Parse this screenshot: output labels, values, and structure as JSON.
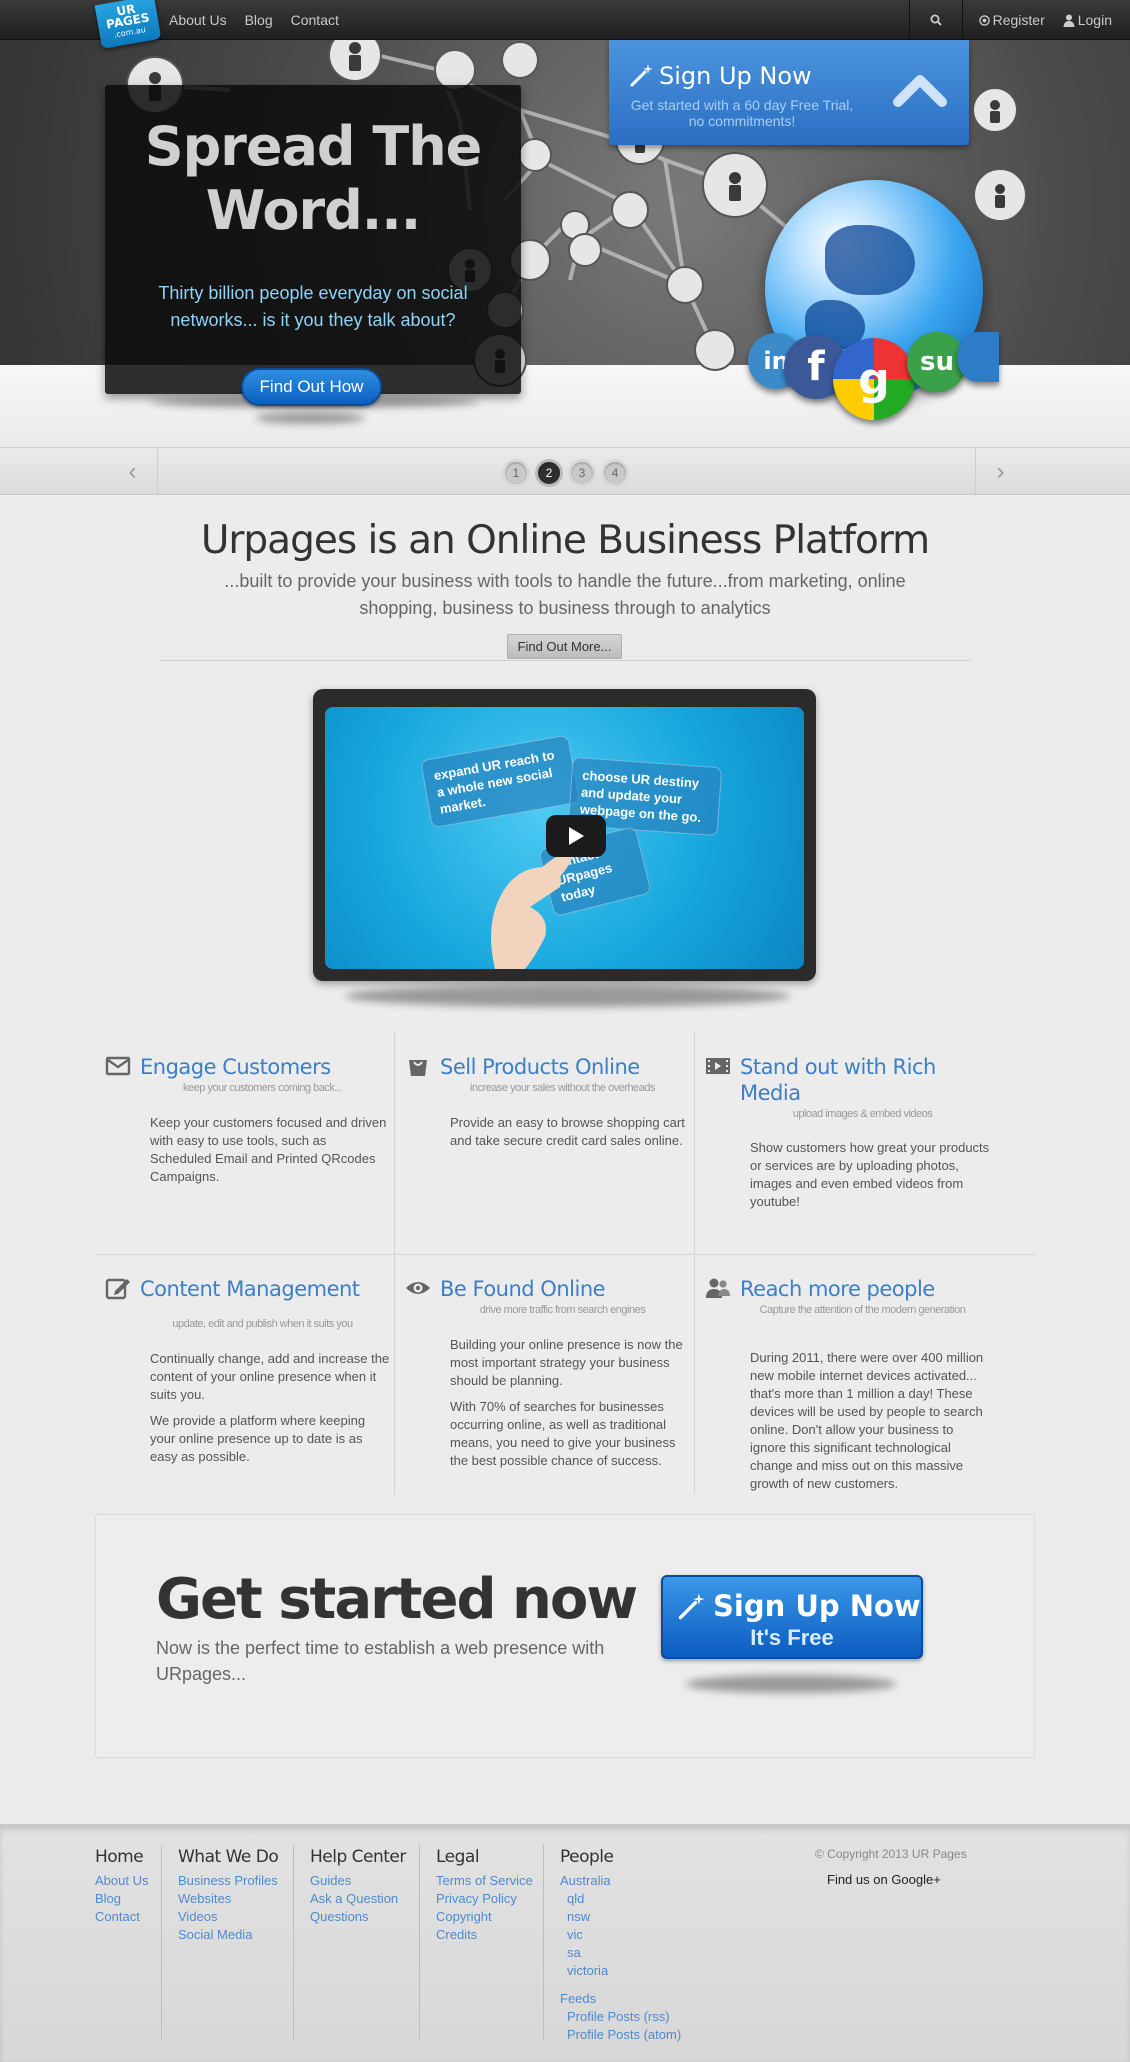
{
  "nav": {
    "logo_line1": "UR",
    "logo_line2": "PAGES",
    "logo_line3": ".com.au",
    "links": [
      "About Us",
      "Blog",
      "Contact"
    ],
    "register": "Register",
    "login": "Login"
  },
  "hero": {
    "title": "Spread The Word...",
    "subtitle": "Thirty billion people everyday on social networks... is it you they talk about?",
    "button": "Find Out How",
    "signup_title": "Sign Up Now",
    "signup_sub": "Get started with a 60 day Free Trial, no commitments!"
  },
  "slider": {
    "prev": "‹",
    "next": "›",
    "pages": [
      "1",
      "2",
      "3",
      "4"
    ],
    "active_page": 2
  },
  "intro": {
    "title": "Urpages is an Online Business Platform",
    "subtitle": "...built to provide your business with tools to handle the future...from marketing, online shopping, business to business through to analytics",
    "button": "Find Out More..."
  },
  "video": {
    "card1": "expand UR reach to a whole new social market.",
    "card2": "choose UR destiny and update your webpage on the go.",
    "card3": "contact URpages today"
  },
  "features": [
    {
      "icon": "envelope-icon",
      "title": "Engage Customers",
      "tagline": "keep your customers coming back...",
      "text": [
        "Keep your customers focused and driven with easy to use tools, such as Scheduled Email and Printed QRcodes Campaigns."
      ]
    },
    {
      "icon": "basket-icon",
      "title": "Sell Products Online",
      "tagline": "increase your sales without the overheads",
      "text": [
        "Provide an easy to browse shopping cart and take secure credit card sales online."
      ]
    },
    {
      "icon": "film-icon",
      "title": "Stand out with Rich Media",
      "tagline": "upload images & embed videos",
      "text": [
        "Show customers how great your products or services are by uploading photos, images and even embed videos from youtube!"
      ]
    },
    {
      "icon": "edit-icon",
      "title": "Content Management",
      "tagline": "update, edit and publish when it suits you",
      "text": [
        "Continually change, add and increase the content of your online presence when it suits you.",
        "We provide a platform where keeping your online presence up to date is as easy as possible."
      ]
    },
    {
      "icon": "eye-icon",
      "title": "Be Found Online",
      "tagline": "drive more traffic from search engines",
      "text": [
        "Building your online presence is now the most important strategy your business should be planning.",
        "With 70% of searches for businesses occurring online, as well as traditional means, you need to give your business the best possible chance of success."
      ]
    },
    {
      "icon": "people-icon",
      "title": "Reach more people",
      "tagline": "Capture the attention of the modern generation",
      "text": [
        "During 2011, there were over 400 million new mobile internet devices activated... that's more than 1 million a day! These devices will be used by people to search online. Don't allow your business to ignore this significant technological change and miss out on this massive growth of new customers."
      ]
    }
  ],
  "get_started": {
    "title": "Get started now",
    "subtitle": "Now is the perfect time to establish a web presence with URpages...",
    "button_line1": "Sign Up Now",
    "button_line2": "It's Free"
  },
  "footer": {
    "home": {
      "title": "Home",
      "links": [
        "About Us",
        "Blog",
        "Contact"
      ]
    },
    "what": {
      "title": "What We Do",
      "links": [
        "Business Profiles",
        "Websites",
        "Videos",
        "Social Media"
      ]
    },
    "help": {
      "title": "Help Center",
      "links": [
        "Guides",
        "Ask a Question",
        "Questions"
      ]
    },
    "legal": {
      "title": "Legal",
      "links": [
        "Terms of Service",
        "Privacy Policy",
        "Copyright",
        "Credits"
      ]
    },
    "people": {
      "title": "People",
      "country": "Australia",
      "states": [
        "qld",
        "nsw",
        "vic",
        "sa",
        "victoria"
      ],
      "feeds": "Feeds",
      "feed_links": [
        "Profile Posts (rss)",
        "Profile Posts (atom)"
      ]
    },
    "copyright": "© Copyright 2013 UR Pages",
    "gplus": "Find us on Google+"
  },
  "colors": {
    "accent": "#3b7fc9",
    "button_blue": "#0b5fc0",
    "nav_bg": "#2a2a2a",
    "hero_text": "#8fd3f6"
  }
}
